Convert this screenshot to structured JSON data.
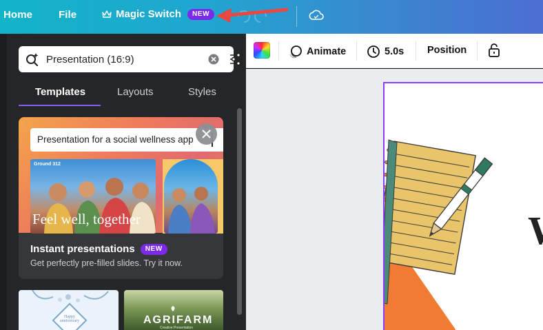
{
  "topbar": {
    "home": "Home",
    "file": "File",
    "magic_switch": "Magic Switch",
    "magic_badge": "NEW"
  },
  "search": {
    "value": "Presentation (16:9)"
  },
  "tabs": [
    {
      "label": "Templates",
      "active": true
    },
    {
      "label": "Layouts",
      "active": false
    },
    {
      "label": "Styles",
      "active": false
    }
  ],
  "promo_card": {
    "prompt_text": "Presentation for a social wellness app",
    "slide_brand": "Ground 312",
    "slide_tagline": "Feel well, together",
    "title": "Instant presentations",
    "badge": "NEW",
    "subtitle": "Get perfectly pre-filled slides. Try it now."
  },
  "thumbnails": [
    {
      "text": "Happy anniversary"
    },
    {
      "title": "AGRIFARM",
      "subtitle": "Creative Presentation"
    }
  ],
  "toolbar": {
    "animate": "Animate",
    "duration": "5.0s",
    "position": "Position"
  },
  "canvas": {
    "heading_fragment": "W"
  },
  "colors": {
    "accent": "#8b3dff",
    "badge": "#7d2ae8",
    "arrow": "#e8483f"
  }
}
